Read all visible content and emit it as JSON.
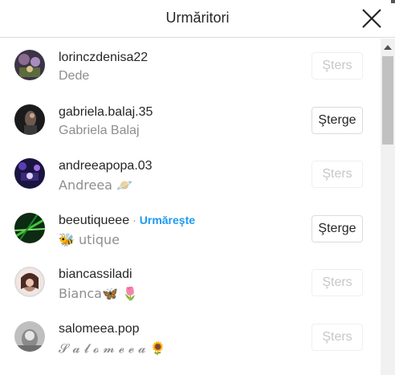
{
  "dialog": {
    "title": "Urmăritori"
  },
  "rows": [
    {
      "username": "lorinczdenisa22",
      "fullname": "Dede",
      "button": "Şters",
      "button_state": "disabled",
      "follow_link": ""
    },
    {
      "username": "gabriela.balaj.35",
      "fullname": "Gabriela Balaj",
      "button": "Şterge",
      "button_state": "enabled",
      "follow_link": ""
    },
    {
      "username": "andreeapopa.03",
      "fullname": "Andreea 🪐",
      "button": "Şters",
      "button_state": "disabled",
      "follow_link": ""
    },
    {
      "username": "beeutiqueee",
      "fullname": "🐝 utique",
      "button": "Şterge",
      "button_state": "enabled",
      "follow_link": "Urmăreşte",
      "separator": "·"
    },
    {
      "username": "biancassiladi",
      "fullname": "Bianca🦋 🌷",
      "button": "Şters",
      "button_state": "disabled",
      "follow_link": ""
    },
    {
      "username": "salomeea.pop",
      "fullname": "𝓢 𝓪 𝓵 𝓸 𝓶 𝓮 𝓮 𝓪 🌻",
      "button": "Şters",
      "button_state": "disabled",
      "follow_link": ""
    }
  ],
  "colors": {
    "link": "#1a9af2",
    "secondary_text": "#8e8e8e",
    "disabled_text": "#c7c7c7"
  }
}
